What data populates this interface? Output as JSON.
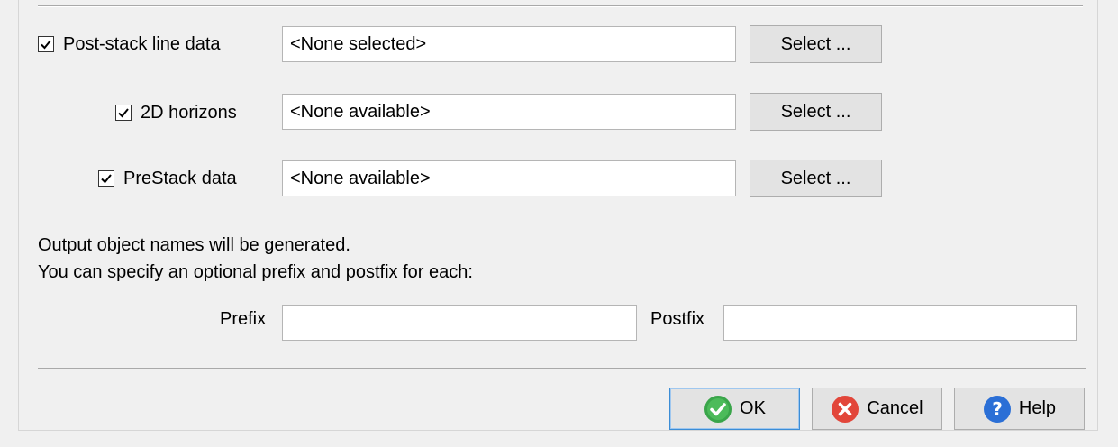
{
  "inputs": [
    {
      "checked": true,
      "label": "Post-stack line data",
      "value": "<None selected>",
      "button": "Select ..."
    },
    {
      "checked": true,
      "label": "2D horizons",
      "value": "<None available>",
      "button": "Select ..."
    },
    {
      "checked": true,
      "label": "PreStack data",
      "value": "<None available>",
      "button": "Select ..."
    }
  ],
  "message": {
    "line1": "Output object names will be generated.",
    "line2": "You can specify an optional prefix and postfix for each:"
  },
  "prefix": {
    "label": "Prefix",
    "value": ""
  },
  "postfix": {
    "label": "Postfix",
    "value": ""
  },
  "buttons": {
    "ok": {
      "label": "OK",
      "icon": "ok-check-icon",
      "color": "#3aa54a"
    },
    "cancel": {
      "label": "Cancel",
      "icon": "cancel-x-icon",
      "color": "#e2463a"
    },
    "help": {
      "label": "Help",
      "icon": "help-question-icon",
      "color": "#2b6fd6"
    }
  }
}
